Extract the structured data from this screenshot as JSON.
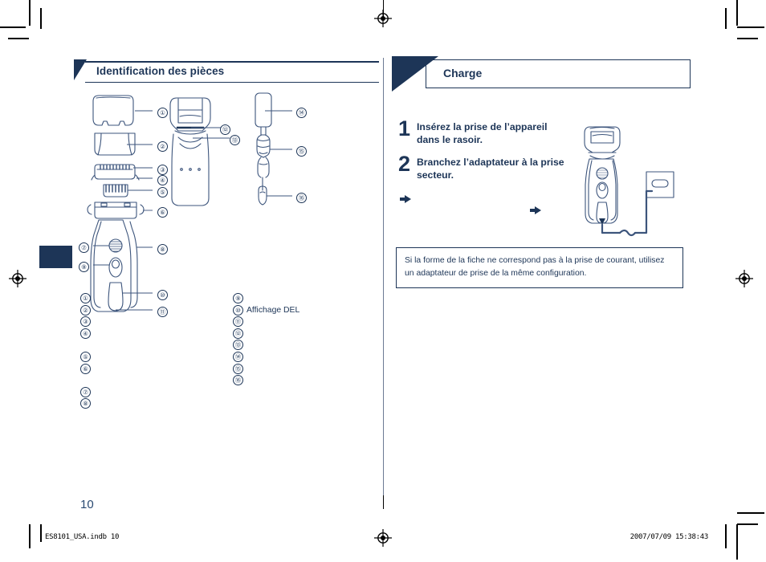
{
  "document": {
    "page_number": "10",
    "footer_left": "ES8101_USA.indb   10",
    "footer_right": "2007/07/09   15:38:43"
  },
  "left_section": {
    "title": "Identification des pièces",
    "legend_col_a": [
      {
        "num": "①",
        "label": ""
      },
      {
        "num": "②",
        "label": ""
      },
      {
        "num": "③",
        "label": ""
      },
      {
        "num": "④",
        "label": ""
      },
      {
        "num": "",
        "label": ""
      },
      {
        "num": "⑤",
        "label": ""
      },
      {
        "num": "⑥",
        "label": ""
      },
      {
        "num": "",
        "label": ""
      },
      {
        "num": "⑦",
        "label": ""
      },
      {
        "num": "⑧",
        "label": ""
      }
    ],
    "legend_col_b": [
      {
        "num": "⑨",
        "label": ""
      },
      {
        "num": "⑩",
        "label": "Affichage DEL"
      },
      {
        "num": "⑪",
        "label": ""
      },
      {
        "num": "⑫",
        "label": ""
      },
      {
        "num": "⑬",
        "label": ""
      },
      {
        "num": "⑭",
        "label": ""
      },
      {
        "num": "⑮",
        "label": ""
      },
      {
        "num": "⑯",
        "label": ""
      }
    ],
    "callouts": {
      "c1": "①",
      "c2": "②",
      "c3": "③",
      "c4": "④",
      "c5": "⑤",
      "c6": "⑥",
      "c7": "⑦",
      "c8": "⑧",
      "c9": "⑨",
      "c10": "⑩",
      "c11": "⑪",
      "c12": "⑫",
      "c13": "⑬",
      "c14": "⑭",
      "c15": "⑮",
      "c16": "⑯"
    }
  },
  "right_section": {
    "title": "Charge",
    "steps": [
      {
        "num": "1",
        "text": "Insérez la prise de l’appareil dans le rasoir."
      },
      {
        "num": "2",
        "text": "Branchez l’adaptateur à la prise secteur."
      }
    ],
    "note": "Si la forme de la fiche ne correspond pas à la prise de courant, utilisez un adaptateur de prise de la même configuration."
  },
  "colors": {
    "navy": "#1d3557",
    "line": "#3d557c",
    "page_number": "#2a4a72"
  }
}
